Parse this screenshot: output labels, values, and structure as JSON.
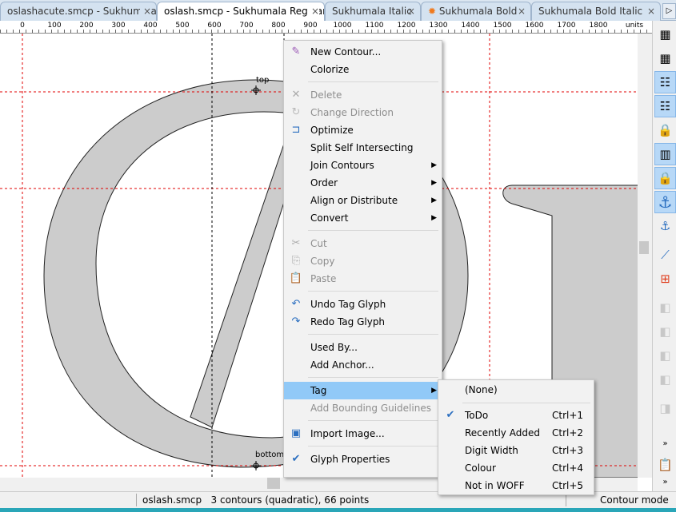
{
  "tabs": [
    {
      "label": "oslashacute.smcp - Sukhumala Regular",
      "close": "×"
    },
    {
      "label": "oslash.smcp - Sukhumala Regular",
      "close": "×"
    },
    {
      "label": "Sukhumala Italic",
      "close": "×"
    },
    {
      "label": "Sukhumala Bold",
      "close": "×",
      "icon": "gear-icon"
    },
    {
      "label": "Sukhumala Bold Italic",
      "close": "×"
    }
  ],
  "ruler": {
    "ticks": [
      "0",
      "100",
      "200",
      "300",
      "400",
      "500",
      "600",
      "700",
      "800",
      "900",
      "1000",
      "1100",
      "1200",
      "1300",
      "1400",
      "1500",
      "1600",
      "1700",
      "1800"
    ],
    "units": "units"
  },
  "canvas": {
    "anchor_top": "top",
    "anchor_bottom": "bottom",
    "glyph_fill": "#cccccc",
    "guide_color": "#e00000"
  },
  "context_menu": [
    {
      "label": "New Contour...",
      "icon": "pencil-icon",
      "enabled": true
    },
    {
      "label": "Colorize",
      "enabled": true
    },
    {
      "label": "Delete",
      "icon": "delete-x-icon",
      "enabled": false
    },
    {
      "label": "Change Direction",
      "icon": "change-direction-icon",
      "enabled": false
    },
    {
      "label": "Optimize",
      "icon": "optimize-icon",
      "enabled": true
    },
    {
      "label": "Split Self Intersecting",
      "enabled": true
    },
    {
      "label": "Join Contours",
      "submenu": true,
      "enabled": true
    },
    {
      "label": "Order",
      "submenu": true,
      "enabled": true
    },
    {
      "label": "Align or Distribute",
      "submenu": true,
      "enabled": true
    },
    {
      "label": "Convert",
      "submenu": true,
      "enabled": true
    },
    {
      "label": "Cut",
      "icon": "scissors-icon",
      "enabled": false
    },
    {
      "label": "Copy",
      "icon": "copy-icon",
      "enabled": false
    },
    {
      "label": "Paste",
      "icon": "paste-icon",
      "enabled": false
    },
    {
      "label": "Undo Tag Glyph",
      "icon": "undo-icon",
      "enabled": true
    },
    {
      "label": "Redo Tag Glyph",
      "icon": "redo-icon",
      "enabled": true
    },
    {
      "label": "Used By...",
      "enabled": true
    },
    {
      "label": "Add Anchor...",
      "enabled": true
    },
    {
      "label": "Tag",
      "submenu": true,
      "enabled": true,
      "highlighted": true
    },
    {
      "label": "Add Bounding Guidelines",
      "enabled": false
    },
    {
      "label": "Import Image...",
      "icon": "image-icon",
      "enabled": true
    },
    {
      "label": "Glyph Properties",
      "icon": "check-icon",
      "enabled": true
    }
  ],
  "tag_submenu": [
    {
      "label": "(None)",
      "shortcut": ""
    },
    {
      "label": "ToDo",
      "shortcut": "Ctrl+1",
      "checked": true
    },
    {
      "label": "Recently Added",
      "shortcut": "Ctrl+2"
    },
    {
      "label": "Digit Width",
      "shortcut": "Ctrl+3"
    },
    {
      "label": "Colour",
      "shortcut": "Ctrl+4"
    },
    {
      "label": "Not in WOFF",
      "shortcut": "Ctrl+5"
    }
  ],
  "status": {
    "info": "oslash.smcp   3 contours (quadratic), 66 points",
    "mode": "Contour mode"
  }
}
